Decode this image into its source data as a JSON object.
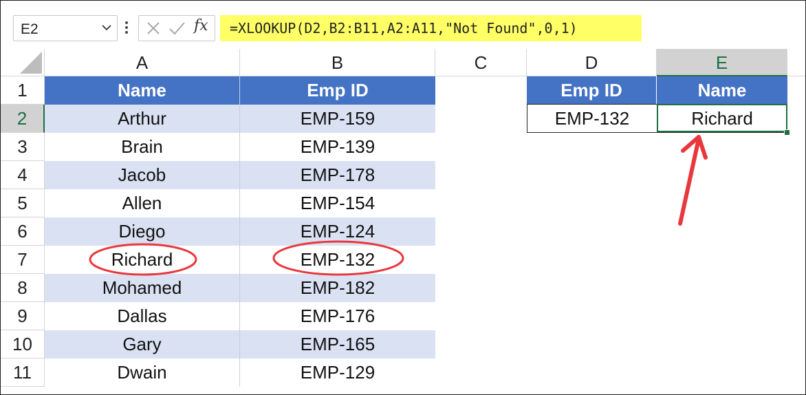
{
  "formula_bar": {
    "name_box": "E2",
    "formula": "=XLOOKUP(D2,B2:B11,A2:A11,\"Not Found\",0,1)",
    "fx_label": "fx"
  },
  "columns": [
    "A",
    "B",
    "C",
    "D",
    "E"
  ],
  "rows": [
    "1",
    "2",
    "3",
    "4",
    "5",
    "6",
    "7",
    "8",
    "9",
    "10",
    "11"
  ],
  "table": {
    "headers": [
      "Name",
      "Emp ID"
    ],
    "rows": [
      [
        "Arthur",
        "EMP-159"
      ],
      [
        "Brain",
        "EMP-139"
      ],
      [
        "Jacob",
        "EMP-178"
      ],
      [
        "Allen",
        "EMP-154"
      ],
      [
        "Diego",
        "EMP-124"
      ],
      [
        "Richard",
        "EMP-132"
      ],
      [
        "Mohamed",
        "EMP-182"
      ],
      [
        "Dallas",
        "EMP-176"
      ],
      [
        "Gary",
        "EMP-165"
      ],
      [
        "Dwain",
        "EMP-129"
      ]
    ]
  },
  "lookup": {
    "headers": [
      "Emp ID",
      "Name"
    ],
    "values": [
      "EMP-132",
      "Richard"
    ]
  },
  "colors": {
    "header_fill": "#4472c4",
    "band_fill": "#d9e1f2",
    "formula_highlight": "#ffff66",
    "selection": "#1f6e43",
    "annotation": "#e8383d"
  }
}
